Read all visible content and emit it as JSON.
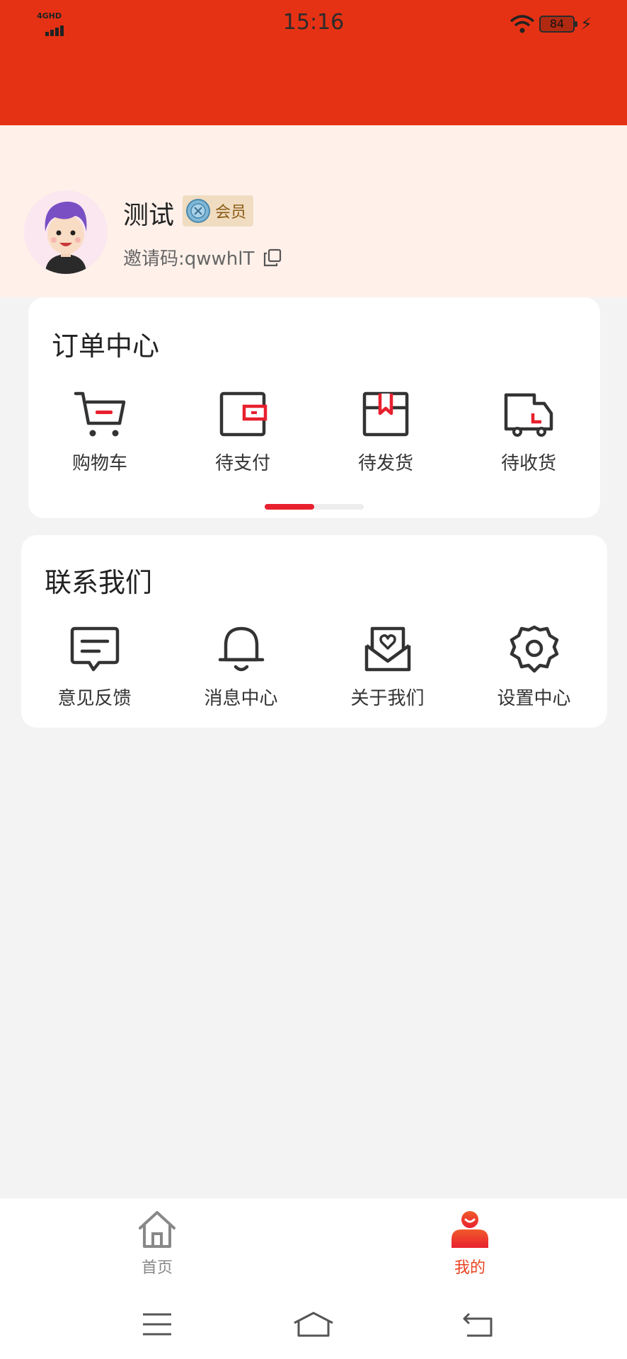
{
  "status_bar": {
    "network": "4GHD",
    "time": "15:16",
    "battery": "84"
  },
  "profile": {
    "username": "测试",
    "badge_label": "会员",
    "invite_code": "邀请码:qwwhlT"
  },
  "order_center": {
    "title": "订单中心",
    "items": [
      {
        "label": "购物车",
        "icon": "cart-icon"
      },
      {
        "label": "待支付",
        "icon": "wallet-icon"
      },
      {
        "label": "待发货",
        "icon": "box-icon"
      },
      {
        "label": "待收货",
        "icon": "truck-icon"
      }
    ],
    "page_indicator": {
      "pages": 2,
      "current": 1
    }
  },
  "contact_us": {
    "title": "联系我们",
    "items": [
      {
        "label": "意见反馈",
        "icon": "feedback-icon"
      },
      {
        "label": "消息中心",
        "icon": "bell-icon"
      },
      {
        "label": "关于我们",
        "icon": "mail-heart-icon"
      },
      {
        "label": "设置中心",
        "icon": "gear-icon"
      }
    ]
  },
  "tabbar": {
    "items": [
      {
        "label": "首页",
        "icon": "home-icon",
        "active": false
      },
      {
        "label": "我的",
        "icon": "person-icon",
        "active": true
      }
    ]
  },
  "colors": {
    "header_red": "#e53214",
    "profile_bg": "#fff1ea",
    "accent_red": "#e8202e",
    "active_tab": "#e8431f"
  }
}
